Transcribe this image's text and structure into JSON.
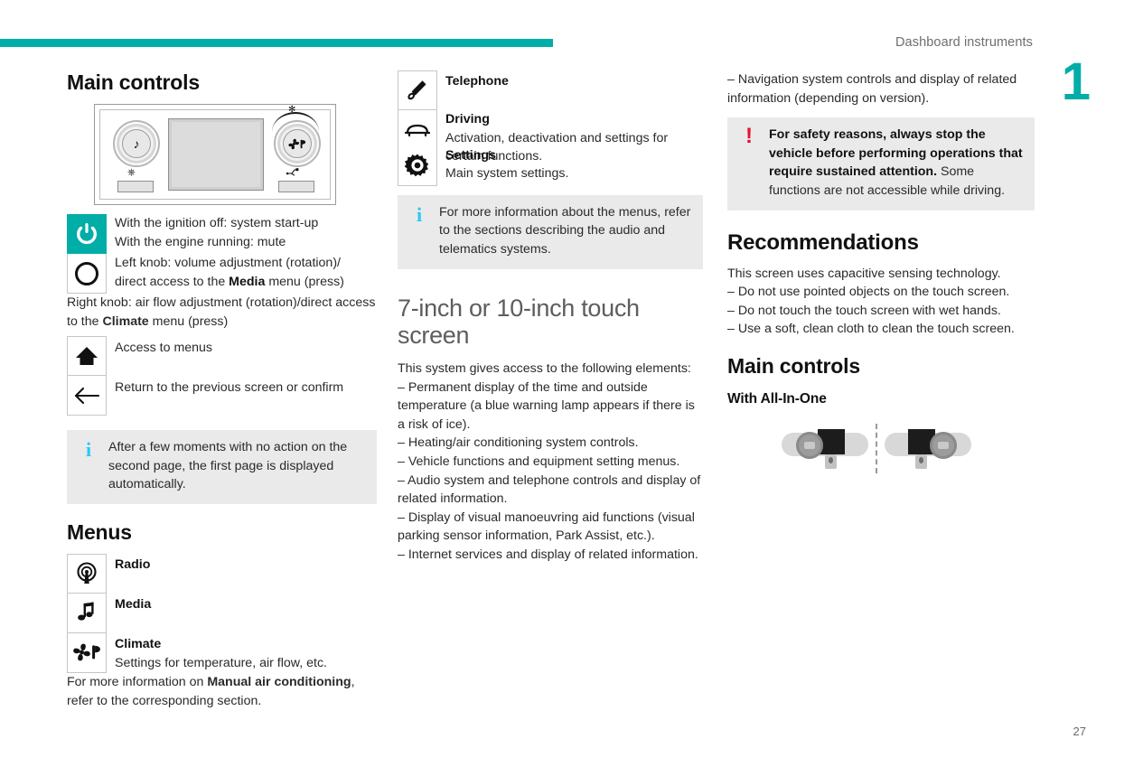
{
  "header": {
    "title": "Dashboard instruments",
    "chapter": "1",
    "page_number": "27"
  },
  "colors": {
    "accent_teal": "#00ADA7",
    "info_blue": "#28C8F5",
    "warning_red": "#E8112D",
    "callout_gray": "#EAEAEA"
  },
  "left_column": {
    "heading": "Main controls",
    "device_illustration": {
      "left_knob_icon": "music-note-icon",
      "right_knob_icon": "fan-climate-icon",
      "left_button_icon": "power-icon",
      "right_button_icon": "usb-icon"
    },
    "controls": [
      {
        "icon": "power-icon",
        "icon_style": "teal",
        "lines": [
          "With the ignition off: system start-up",
          "With the engine running: mute"
        ]
      },
      {
        "icon": "knob-ring-icon",
        "icon_style": "outline",
        "lines": [
          "Left knob: volume adjustment (rotation)/",
          "direct access to the Media menu (press)"
        ],
        "bold_words": [
          "Media"
        ]
      }
    ],
    "right_knob_text_a": "Right knob: air flow adjustment (rotation)/direct ",
    "right_knob_text_b": "access to the ",
    "right_knob_bold": "Climate",
    "right_knob_text_c": " menu (press)",
    "nav_controls": [
      {
        "icon": "home-icon",
        "label": "Access to menus"
      },
      {
        "icon": "back-arrow-icon",
        "label": "Return to the previous screen or confirm"
      }
    ],
    "info_callout": "After a few moments with no action on the second page, the first page is displayed automatically.",
    "menus_heading": "Menus",
    "menus": [
      {
        "icon": "radio-icon",
        "title": "Radio",
        "desc": ""
      },
      {
        "icon": "media-note-icon",
        "title": "Media",
        "desc": ""
      },
      {
        "icon": "climate-fan-icon",
        "title": "Climate",
        "desc": "Settings for temperature, air flow, etc."
      }
    ],
    "menus_footer_a": "For more information on ",
    "menus_footer_bold": "Manual air conditioning",
    "menus_footer_b": ", refer to the corresponding section."
  },
  "middle_column": {
    "menus": [
      {
        "icon": "telephone-icon",
        "title": "Telephone",
        "desc": ""
      },
      {
        "icon": "car-driving-icon",
        "title": "Driving",
        "desc": "Activation, deactivation and settings for certain functions."
      },
      {
        "icon": "settings-gear-icon",
        "title": "Settings",
        "desc": "Main system settings."
      }
    ],
    "info_callout": "For more information about the menus, refer to the sections describing the audio and telematics systems.",
    "touch_heading": "7-inch or 10-inch touch screen",
    "intro": "This system gives access to the following elements:",
    "bullets": [
      "– Permanent display of the time and outside temperature (a blue warning lamp appears if there is a risk of ice).",
      "– Heating/air conditioning system controls.",
      "– Vehicle functions and equipment setting menus.",
      "– Audio system and telephone controls and display of related information.",
      "– Display of visual manoeuvring aid functions (visual parking sensor information, Park Assist, etc.).",
      "– Internet services and display of related information."
    ]
  },
  "right_column": {
    "top_bullet": "– Navigation system controls and display of related information (depending on version).",
    "warning_callout_bold": "For safety reasons, always stop the vehicle before performing operations that require sustained attention.",
    "warning_callout_rest": "Some functions are not accessible while driving.",
    "recommendations_heading": "Recommendations",
    "recommendations_intro": "This screen uses capacitive sensing technology.",
    "recommendations_bullets": [
      "– Do not use pointed objects on the touch screen.",
      "– Do not touch the touch screen with wet hands.",
      "– Use a soft, clean cloth to clean the touch screen."
    ],
    "main_controls_heading": "Main controls",
    "all_in_one_heading": "With All-In-One"
  }
}
